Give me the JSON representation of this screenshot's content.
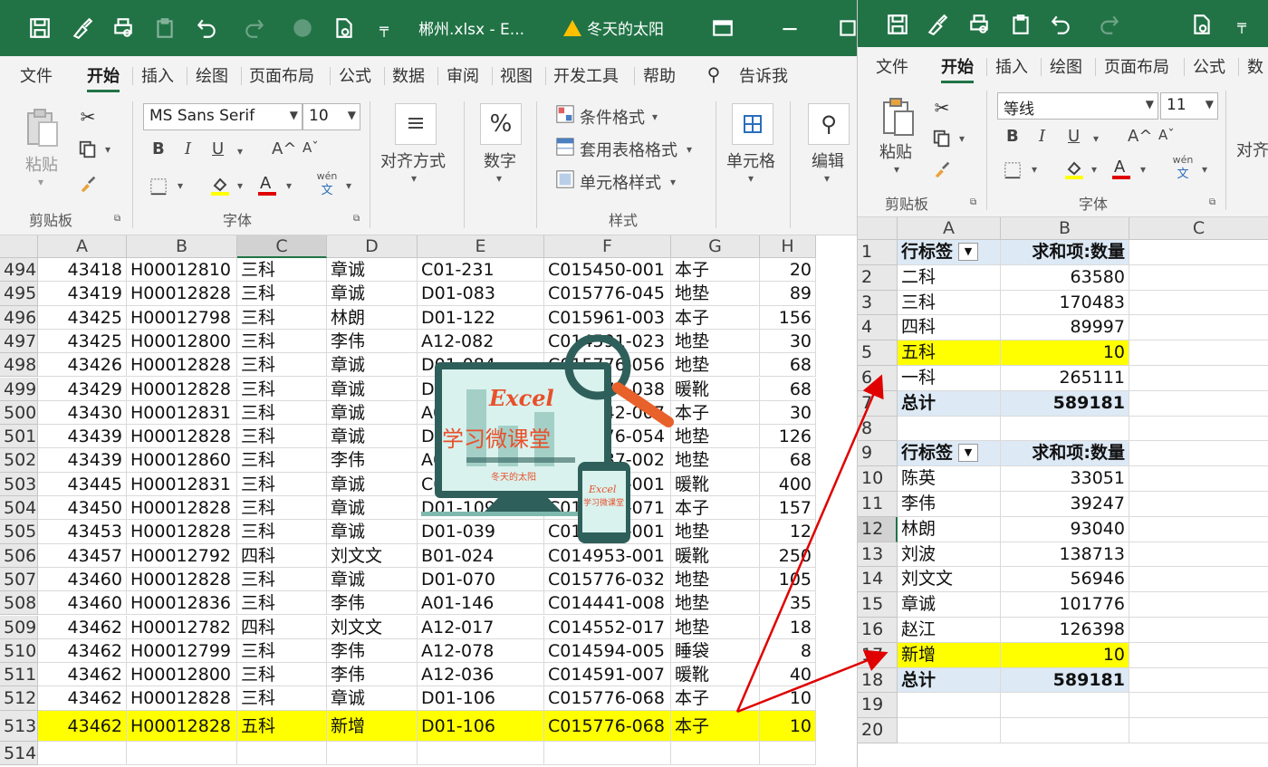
{
  "left": {
    "title": {
      "filename": "郴州.xlsx - E...",
      "user": "冬天的太阳"
    },
    "menu": [
      "文件",
      "开始",
      "插入",
      "绘图",
      "页面布局",
      "公式",
      "数据",
      "审阅",
      "视图",
      "开发工具",
      "帮助"
    ],
    "tell_me": "告诉我",
    "ribbon": {
      "paste": "粘贴",
      "clipboard": "剪贴板",
      "font_name": "MS Sans Serif",
      "font_size": "10",
      "font_group": "字体",
      "align": "对齐方式",
      "number": "数字",
      "cond_format": "条件格式",
      "table_format": "套用表格格式",
      "cell_style": "单元格样式",
      "styles_group": "样式",
      "cells": "单元格",
      "edit": "编辑",
      "bold": "B",
      "italic": "I",
      "underline": "U",
      "grow": "A^",
      "shrink": "Aˇ",
      "phonetic_top": "wén",
      "phonetic_bot": "文"
    },
    "columns": [
      "A",
      "B",
      "C",
      "D",
      "E",
      "F",
      "G",
      "H"
    ],
    "rows": [
      {
        "n": "494",
        "a": "43418",
        "b": "H00012810",
        "c": "三科",
        "d": "章诚",
        "e": "C01-231",
        "f": "C015450-001",
        "g": "本子",
        "h": "20"
      },
      {
        "n": "495",
        "a": "43419",
        "b": "H00012828",
        "c": "三科",
        "d": "章诚",
        "e": "D01-083",
        "f": "C015776-045",
        "g": "地垫",
        "h": "89"
      },
      {
        "n": "496",
        "a": "43425",
        "b": "H00012798",
        "c": "三科",
        "d": "林朗",
        "e": "D01-122",
        "f": "C015961-003",
        "g": "本子",
        "h": "156"
      },
      {
        "n": "497",
        "a": "43425",
        "b": "H00012800",
        "c": "三科",
        "d": "李伟",
        "e": "A12-082",
        "f": "C014591-023",
        "g": "地垫",
        "h": "30"
      },
      {
        "n": "498",
        "a": "43426",
        "b": "H00012828",
        "c": "三科",
        "d": "章诚",
        "e": "D01-084",
        "f": "C015776-056",
        "g": "地垫",
        "h": "68"
      },
      {
        "n": "499",
        "a": "43429",
        "b": "H00012828",
        "c": "三科",
        "d": "章诚",
        "e": "D01-093",
        "f": "C015776-038",
        "g": "暖靴",
        "h": "68"
      },
      {
        "n": "500",
        "a": "43430",
        "b": "H00012831",
        "c": "三科",
        "d": "章诚",
        "e": "A01-011",
        "f": "C014542-007",
        "g": "本子",
        "h": "30"
      },
      {
        "n": "501",
        "a": "43439",
        "b": "H00012828",
        "c": "三科",
        "d": "章诚",
        "e": "D01-093",
        "f": "C015776-054",
        "g": "地垫",
        "h": "126"
      },
      {
        "n": "502",
        "a": "43439",
        "b": "H00012860",
        "c": "三科",
        "d": "李伟",
        "e": "A01-010",
        "f": "C014587-002",
        "g": "地垫",
        "h": "68"
      },
      {
        "n": "503",
        "a": "43445",
        "b": "H00012831",
        "c": "三科",
        "d": "章诚",
        "e": "C01-201",
        "f": "C014980-001",
        "g": "暖靴",
        "h": "400"
      },
      {
        "n": "504",
        "a": "43450",
        "b": "H00012828",
        "c": "三科",
        "d": "章诚",
        "e": "D01-109",
        "f": "C015776-071",
        "g": "本子",
        "h": "157"
      },
      {
        "n": "505",
        "a": "43453",
        "b": "H00012828",
        "c": "三科",
        "d": "章诚",
        "e": "D01-039",
        "f": "C015776-001",
        "g": "地垫",
        "h": "12"
      },
      {
        "n": "506",
        "a": "43457",
        "b": "H00012792",
        "c": "四科",
        "d": "刘文文",
        "e": "B01-024",
        "f": "C014953-001",
        "g": "暖靴",
        "h": "250"
      },
      {
        "n": "507",
        "a": "43460",
        "b": "H00012828",
        "c": "三科",
        "d": "章诚",
        "e": "D01-070",
        "f": "C015776-032",
        "g": "地垫",
        "h": "105"
      },
      {
        "n": "508",
        "a": "43460",
        "b": "H00012836",
        "c": "三科",
        "d": "李伟",
        "e": "A01-146",
        "f": "C014441-008",
        "g": "地垫",
        "h": "35"
      },
      {
        "n": "509",
        "a": "43462",
        "b": "H00012782",
        "c": "四科",
        "d": "刘文文",
        "e": "A12-017",
        "f": "C014552-017",
        "g": "地垫",
        "h": "18"
      },
      {
        "n": "510",
        "a": "43462",
        "b": "H00012799",
        "c": "三科",
        "d": "李伟",
        "e": "A12-078",
        "f": "C014594-005",
        "g": "睡袋",
        "h": "8"
      },
      {
        "n": "511",
        "a": "43462",
        "b": "H00012800",
        "c": "三科",
        "d": "李伟",
        "e": "A12-036",
        "f": "C014591-007",
        "g": "暖靴",
        "h": "40"
      },
      {
        "n": "512",
        "a": "43462",
        "b": "H00012828",
        "c": "三科",
        "d": "章诚",
        "e": "D01-106",
        "f": "C015776-068",
        "g": "本子",
        "h": "10"
      },
      {
        "n": "513",
        "a": "43462",
        "b": "H00012828",
        "c": "五科",
        "d": "新增",
        "e": "D01-106",
        "f": "C015776-068",
        "g": "本子",
        "h": "10"
      },
      {
        "n": "514",
        "a": "",
        "b": "",
        "c": "",
        "d": "",
        "e": "",
        "f": "",
        "g": "",
        "h": ""
      }
    ]
  },
  "right": {
    "menu": [
      "文件",
      "开始",
      "插入",
      "绘图",
      "页面布局",
      "公式",
      "数"
    ],
    "ribbon": {
      "paste": "粘贴",
      "clipboard": "剪贴板",
      "font_name": "等线",
      "font_size": "11",
      "font_group": "字体",
      "align_partial": "对齐",
      "bold": "B",
      "italic": "I",
      "underline": "U",
      "grow": "A^",
      "shrink": "Aˇ",
      "phonetic_top": "wén",
      "phonetic_bot": "文"
    },
    "columns": [
      "A",
      "B",
      "C"
    ],
    "rows": [
      {
        "n": "1",
        "a": "行标签",
        "b": "求和项:数量",
        "t": "head"
      },
      {
        "n": "2",
        "a": "二科",
        "b": "63580",
        "t": ""
      },
      {
        "n": "3",
        "a": "三科",
        "b": "170483",
        "t": ""
      },
      {
        "n": "4",
        "a": "四科",
        "b": "89997",
        "t": ""
      },
      {
        "n": "5",
        "a": "五科",
        "b": "10",
        "t": "hl"
      },
      {
        "n": "6",
        "a": "一科",
        "b": "265111",
        "t": ""
      },
      {
        "n": "7",
        "a": "总计",
        "b": "589181",
        "t": "total"
      },
      {
        "n": "8",
        "a": "",
        "b": "",
        "t": ""
      },
      {
        "n": "9",
        "a": "行标签",
        "b": "求和项:数量",
        "t": "head"
      },
      {
        "n": "10",
        "a": "陈英",
        "b": "33051",
        "t": ""
      },
      {
        "n": "11",
        "a": "李伟",
        "b": "39247",
        "t": ""
      },
      {
        "n": "12",
        "a": "林朗",
        "b": "93040",
        "t": ""
      },
      {
        "n": "13",
        "a": "刘波",
        "b": "138713",
        "t": ""
      },
      {
        "n": "14",
        "a": "刘文文",
        "b": "56946",
        "t": ""
      },
      {
        "n": "15",
        "a": "章诚",
        "b": "101776",
        "t": ""
      },
      {
        "n": "16",
        "a": "赵江",
        "b": "126398",
        "t": ""
      },
      {
        "n": "17",
        "a": "新增",
        "b": "10",
        "t": "hl"
      },
      {
        "n": "18",
        "a": "总计",
        "b": "589181",
        "t": "total"
      },
      {
        "n": "19",
        "a": "",
        "b": "",
        "t": ""
      },
      {
        "n": "20",
        "a": "",
        "b": "",
        "t": ""
      }
    ]
  },
  "watermark": {
    "title": "Excel",
    "subtitle": "学习微课堂",
    "author": "冬天的太阳",
    "phone_title": "Excel",
    "phone_sub": "学习微课堂"
  },
  "colors": {
    "excel_green": "#217346",
    "highlight": "#ffff00",
    "pivot_header": "#dde9f5",
    "arrow": "#e00000"
  }
}
